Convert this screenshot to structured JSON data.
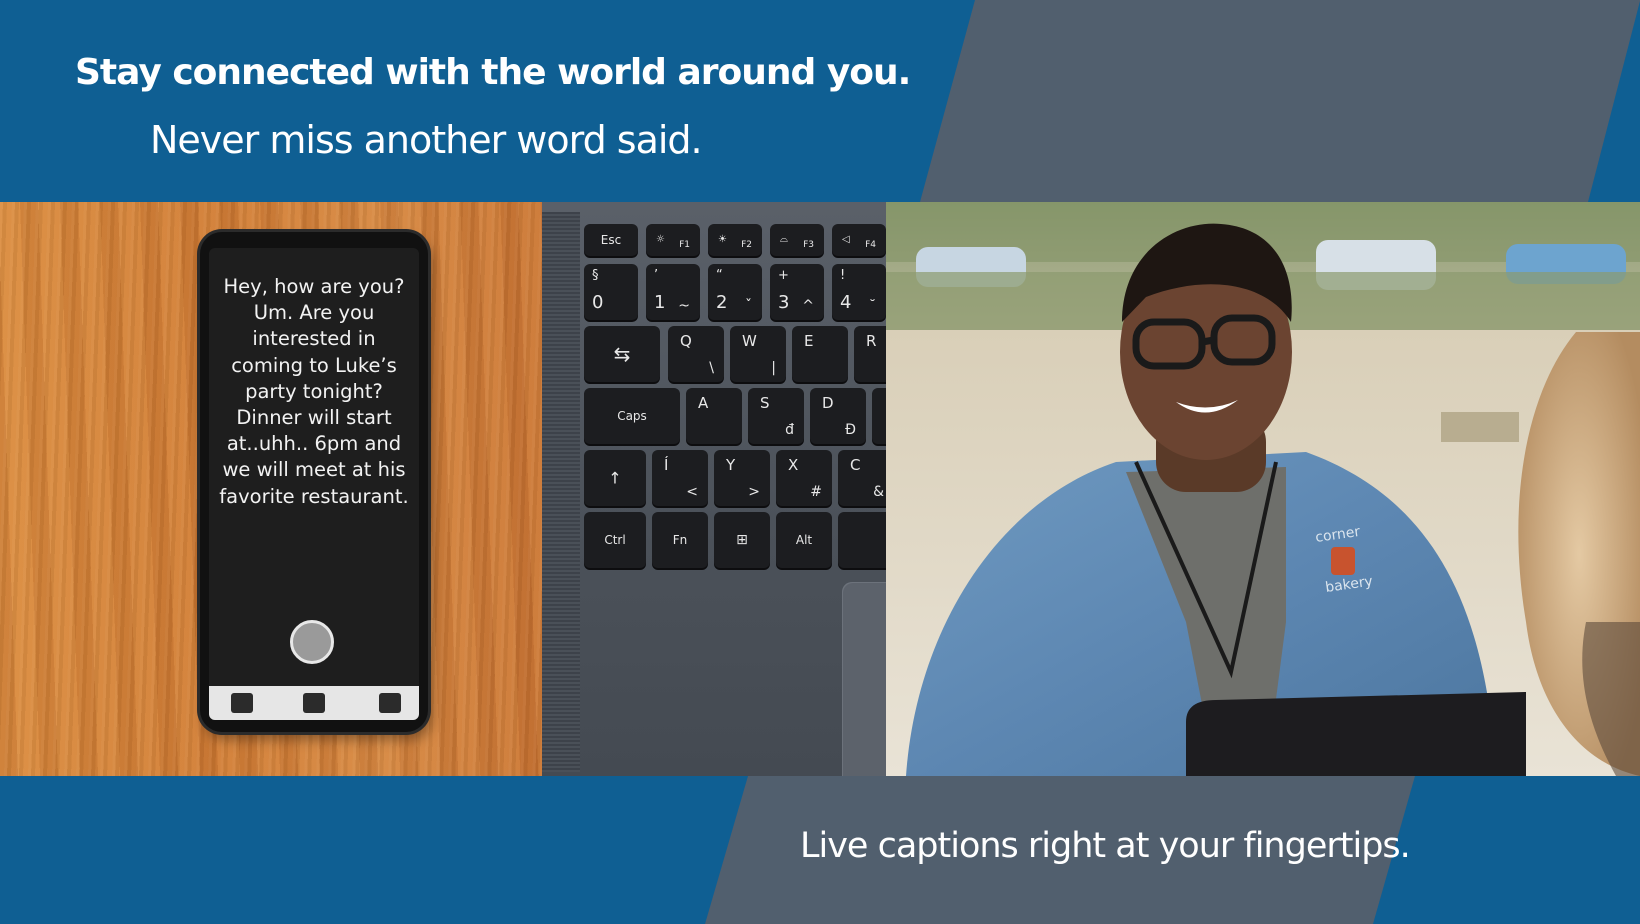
{
  "headline": "Stay connected with the world around you.",
  "subhead": "Never miss another word said.",
  "tagline": "Live captions right at your fingertips.",
  "phone": {
    "caption_text": "Hey, how are you? Um. Are you interested in coming to Luke’s party tonight? Dinner will start at..uhh.. 6pm and we will meet at his favorite restaurant."
  },
  "keyboard": {
    "esc": "Esc",
    "f1": "F1",
    "f2": "F2",
    "f3": "F3",
    "f4": "F4",
    "row1": [
      {
        "top": "§",
        "bottom": "0"
      },
      {
        "top": "’",
        "bottom": "1",
        "alt": "~"
      },
      {
        "top": "“",
        "bottom": "2",
        "alt": "ˇ"
      },
      {
        "top": "+",
        "bottom": "3",
        "alt": "^"
      },
      {
        "top": "!",
        "bottom": "4",
        "alt": "˘"
      }
    ],
    "row2": [
      {
        "top": "Q",
        "alt": "\\"
      },
      {
        "top": "W",
        "alt": "|"
      },
      {
        "top": "E",
        "alt": ""
      },
      {
        "top": "R",
        "alt": ""
      }
    ],
    "caps": "Caps",
    "row3": [
      {
        "top": "A",
        "alt": ""
      },
      {
        "top": "S",
        "alt": "đ"
      },
      {
        "top": "D",
        "alt": "Đ"
      }
    ],
    "row4": [
      {
        "top": "Í",
        "alt": "<"
      },
      {
        "top": "Y",
        "alt": ">"
      },
      {
        "top": "X",
        "alt": "#"
      },
      {
        "top": "C",
        "alt": "&"
      }
    ],
    "ctrl": "Ctrl",
    "fn": "Fn",
    "alt": "Alt"
  },
  "photo": {
    "shirt_logo_top": "corner",
    "shirt_logo_bottom": "bakery"
  },
  "colors": {
    "brand_blue": "#0f5f93",
    "slate": "#515f6e",
    "text": "#ffffff"
  }
}
